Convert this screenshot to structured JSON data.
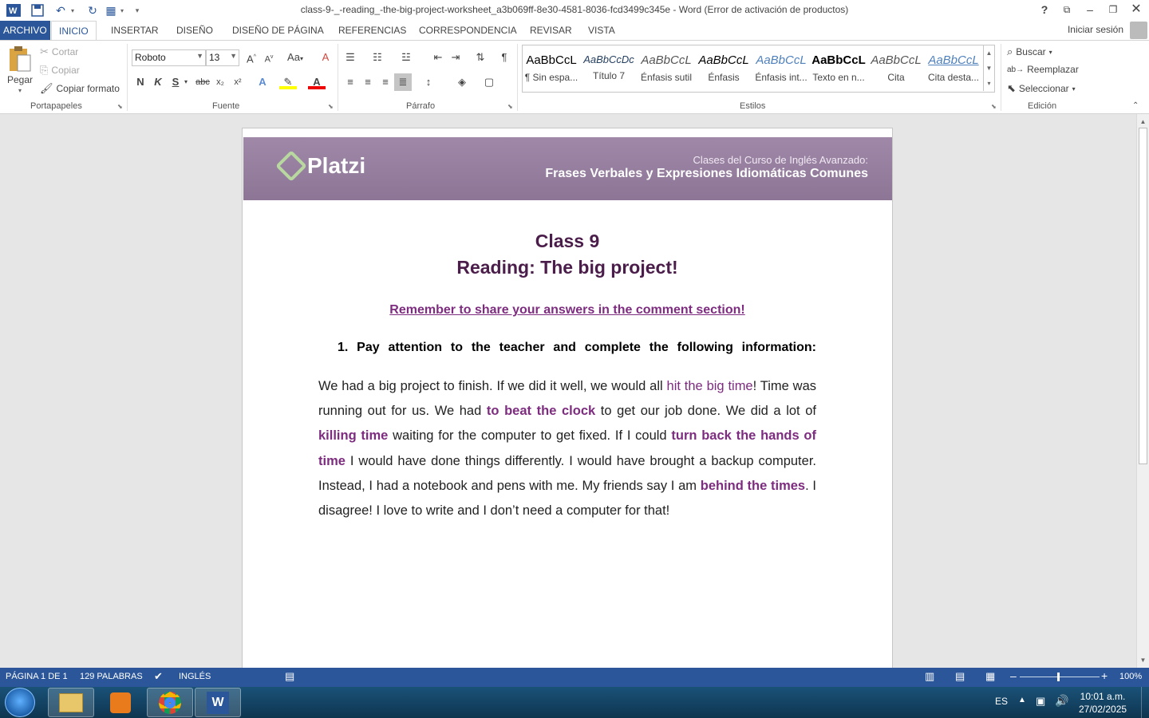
{
  "window": {
    "title": "class-9-_-reading_-the-big-project-worksheet_a3b069ff-8e30-4581-8036-fcd3499c345e - Word (Error de activación de productos)",
    "help": "?"
  },
  "tabs": [
    {
      "label": "ARCHIVO"
    },
    {
      "label": "INICIO"
    },
    {
      "label": "INSERTAR"
    },
    {
      "label": "DISEÑO"
    },
    {
      "label": "DISEÑO DE PÁGINA"
    },
    {
      "label": "REFERENCIAS"
    },
    {
      "label": "CORRESPONDENCIA"
    },
    {
      "label": "REVISAR"
    },
    {
      "label": "VISTA"
    }
  ],
  "signin": "Iniciar sesión",
  "ribbon": {
    "clipboard": {
      "paste": "Pegar",
      "cut": "Cortar",
      "copy": "Copiar",
      "format_painter": "Copiar formato",
      "label": "Portapapeles"
    },
    "font": {
      "family": "Roboto",
      "size": "13",
      "label": "Fuente",
      "bold": "N",
      "italic": "K",
      "underline": "S",
      "strike": "abc",
      "sub": "x₂",
      "sup": "x²",
      "case": "Aa"
    },
    "paragraph": {
      "label": "Párrafo"
    },
    "styles": {
      "label": "Estilos",
      "items": [
        {
          "sample": "AaBbCcL",
          "name": "¶ Sin espa..."
        },
        {
          "sample": "AaBbCcDc",
          "name": "Título 7"
        },
        {
          "sample": "AaBbCcL",
          "name": "Énfasis sutil"
        },
        {
          "sample": "AaBbCcL",
          "name": "Énfasis"
        },
        {
          "sample": "AaBbCcL",
          "name": "Énfasis int..."
        },
        {
          "sample": "AaBbCcL",
          "name": "Texto en n..."
        },
        {
          "sample": "AaBbCcL",
          "name": "Cita"
        },
        {
          "sample": "AaBbCcL",
          "name": "Cita desta..."
        }
      ]
    },
    "editing": {
      "find": "Buscar",
      "replace": "Reemplazar",
      "select": "Seleccionar",
      "label": "Edición"
    }
  },
  "document": {
    "banner": {
      "logo": "Platzi",
      "line1": "Clases del Curso de Inglés Avanzado:",
      "line2": "Frases Verbales y Expresiones Idiomáticas Comunes"
    },
    "class_title": "Class 9",
    "reading_title": "Reading: The big project!",
    "remember": "Remember to share your answers in the comment section!",
    "instruction": "1.  Pay attention to the teacher and complete the following information:",
    "paragraph": {
      "p1": "We had a big project to finish.  If we did it well, we would all ",
      "i1": "hit the big time",
      "p2": "! Time was running out for us. We had ",
      "i2": "to beat the clock",
      "p3": " to get our job done. We did a lot of ",
      "i3": "killing time",
      "p4": " waiting for the computer to get fixed. If I could ",
      "i4": "turn back the hands of time",
      "p5": " I would have done things differently. I would have brought a backup computer.  Instead, I had   a notebook and pens with me. My friends say I am ",
      "i5": "behind the times",
      "p6": ". I disagree! I love to write and I don’t need a computer for that!"
    }
  },
  "statusbar": {
    "page": "PÁGINA 1 DE 1",
    "words": "129 PALABRAS",
    "language": "INGLÉS",
    "zoom": "100%"
  },
  "taskbar": {
    "lang": "ES",
    "time": "10:01 a.m.",
    "date": "27/02/2025"
  },
  "colors": {
    "word_blue": "#2b579a",
    "heading_purple": "#4b1d4a",
    "idiom_purple": "#7d2c7f",
    "banner": "#9a83a3"
  }
}
